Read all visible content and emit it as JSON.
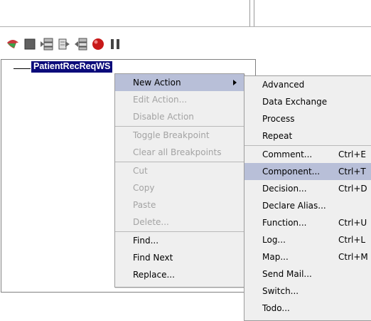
{
  "toolbar": {
    "icons": [
      "bent-arrow-icon",
      "stop-icon",
      "step-into-icon",
      "step-over-icon",
      "step-out-icon",
      "record-icon",
      "pause-icon"
    ],
    "colors": {
      "play": "#c8383c",
      "stop": "#606060",
      "record": "#c81818",
      "pause": "#444444"
    }
  },
  "tree": {
    "root_label": "PatientRecReqWS",
    "selection_color": "#0b0b7a"
  },
  "context_menu": {
    "items": [
      {
        "label": "New Action",
        "disabled": false,
        "submenu": true,
        "highlight": true
      },
      {
        "label": "Edit Action...",
        "disabled": true
      },
      {
        "label": "Disable Action",
        "disabled": true
      },
      {
        "label": "Toggle Breakpoint",
        "disabled": true
      },
      {
        "label": "Clear all Breakpoints",
        "disabled": true
      },
      {
        "label": "Cut",
        "disabled": true
      },
      {
        "label": "Copy",
        "disabled": true
      },
      {
        "label": "Paste",
        "disabled": true
      },
      {
        "label": "Delete...",
        "disabled": true
      },
      {
        "label": "Find...",
        "disabled": false
      },
      {
        "label": "Find Next",
        "disabled": false
      },
      {
        "label": "Replace...",
        "disabled": false
      }
    ]
  },
  "new_action_submenu": {
    "items": [
      {
        "label": "Advanced",
        "submenu": true
      },
      {
        "label": "Data Exchange",
        "submenu": true
      },
      {
        "label": "Process",
        "submenu": true
      },
      {
        "label": "Repeat",
        "submenu": true
      },
      {
        "label": "Comment...",
        "shortcut": "Ctrl+E"
      },
      {
        "label": "Component...",
        "shortcut": "Ctrl+T",
        "highlight": true
      },
      {
        "label": "Decision...",
        "shortcut": "Ctrl+D"
      },
      {
        "label": "Declare Alias..."
      },
      {
        "label": "Function...",
        "shortcut": "Ctrl+U"
      },
      {
        "label": "Log...",
        "shortcut": "Ctrl+L"
      },
      {
        "label": "Map...",
        "shortcut": "Ctrl+M"
      },
      {
        "label": "Send Mail..."
      },
      {
        "label": "Switch..."
      },
      {
        "label": "Todo..."
      }
    ],
    "highlight_color": "#b8bfd8"
  }
}
